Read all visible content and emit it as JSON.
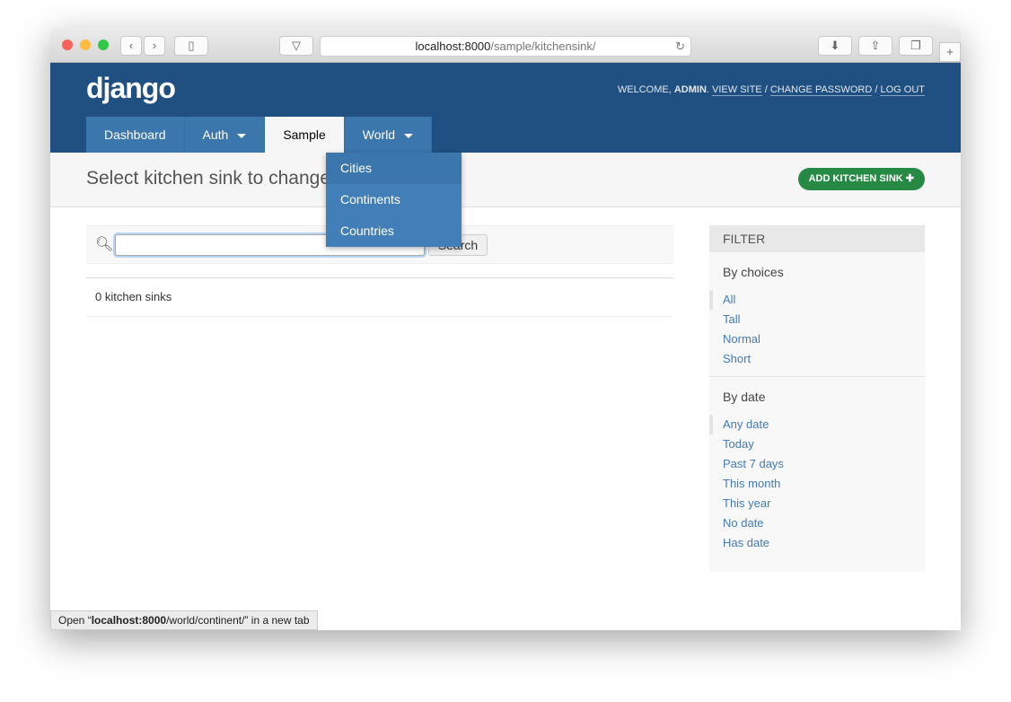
{
  "browser": {
    "url_host": "localhost:8000",
    "url_path": "/sample/kitchensink/"
  },
  "header": {
    "logo": "django",
    "welcome": "Welcome, ",
    "user": "admin",
    "view_site": "View site",
    "change_password": "Change password",
    "logout": "Log out"
  },
  "nav": [
    {
      "label": "Dashboard"
    },
    {
      "label": "Auth"
    },
    {
      "label": "Sample"
    },
    {
      "label": "World"
    }
  ],
  "dropdown": [
    "Cities",
    "Continents",
    "Countries"
  ],
  "page": {
    "title": "Select kitchen sink to change",
    "add_button": "ADD KITCHEN SINK",
    "search_value": "",
    "search_button": "Search",
    "count": "0 kitchen sinks"
  },
  "filter": {
    "title": "FILTER",
    "groups": [
      {
        "title": "By choices",
        "items": [
          "All",
          "Tall",
          "Normal",
          "Short"
        ]
      },
      {
        "title": "By date",
        "items": [
          "Any date",
          "Today",
          "Past 7 days",
          "This month",
          "This year",
          "No date",
          "Has date"
        ]
      }
    ]
  },
  "status": {
    "prefix": "Open “",
    "host": "localhost:8000",
    "path": "/world/continent/",
    "suffix": "” in a new tab"
  }
}
